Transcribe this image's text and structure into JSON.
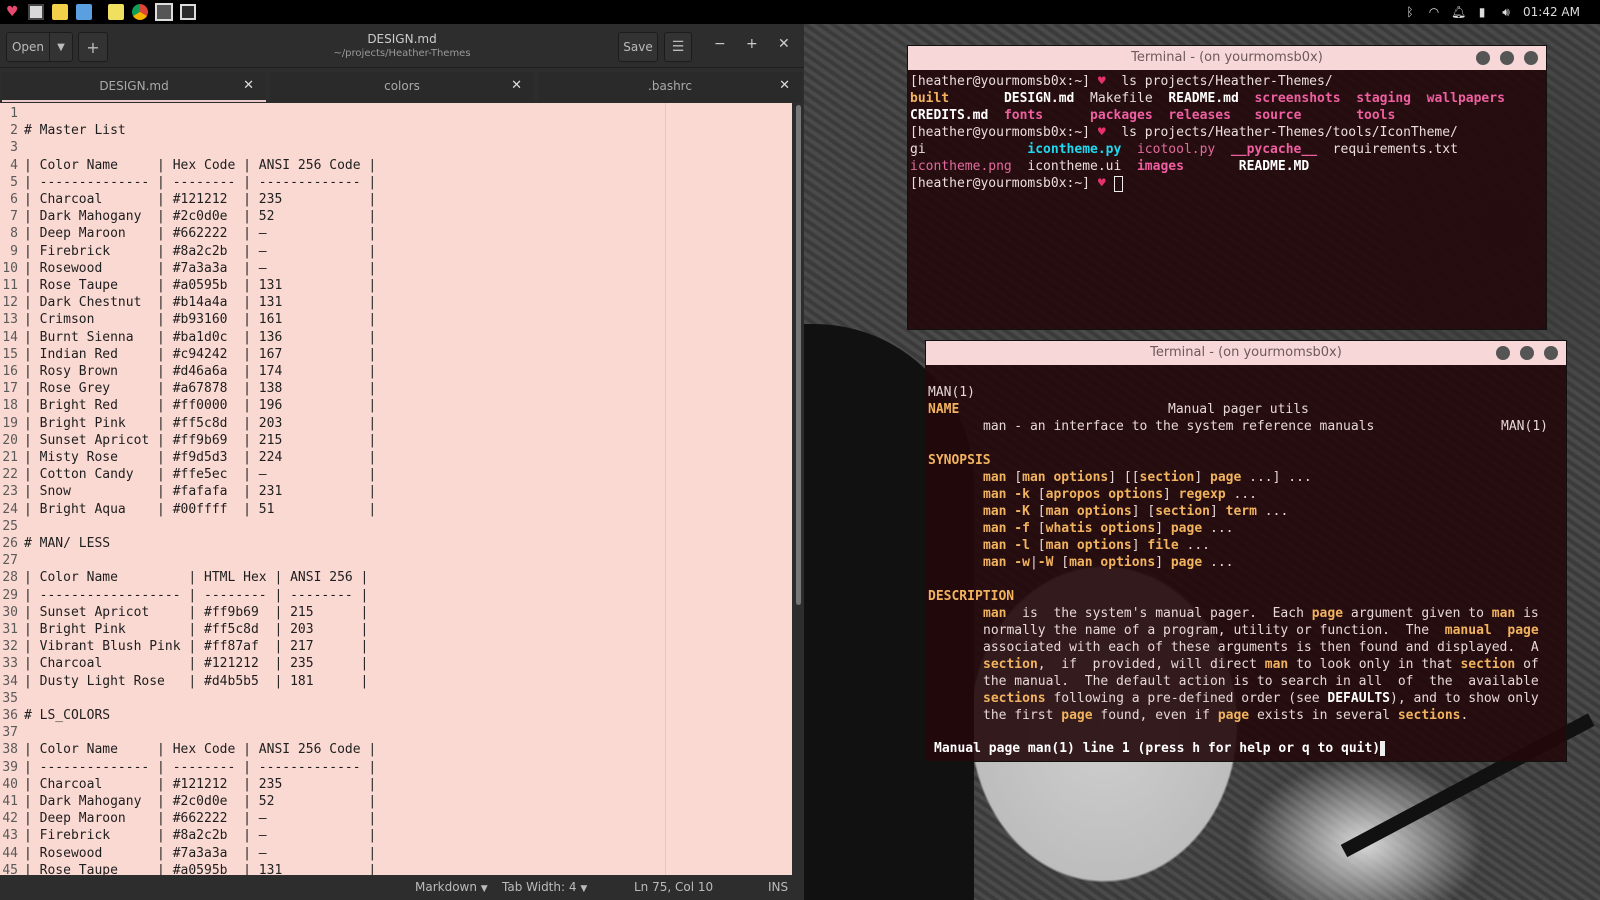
{
  "taskbar": {
    "clock": "01:42 AM",
    "apps": [
      {
        "icon": "heart-menu-icon",
        "color": "#e84a6f"
      },
      {
        "icon": "terminal-app-icon",
        "color": "#cfcfcf"
      },
      {
        "icon": "text-editor-icon",
        "color": "#f2d04a"
      },
      {
        "icon": "screenshot-app-icon",
        "color": "#5aa0e0"
      },
      {
        "icon": "notes-app-icon",
        "color": "#f0e060"
      },
      {
        "icon": "chrome-icon",
        "color": "#db4437"
      },
      {
        "icon": "terminal-app-icon-2",
        "color": "#cfcfcf"
      },
      {
        "icon": "terminal-app-icon-3",
        "color": "#cfcfcf"
      }
    ],
    "tray": [
      "bluetooth-icon",
      "wifi-icon",
      "notification-bell-icon",
      "battery-icon",
      "volume-icon"
    ]
  },
  "editor": {
    "open_label": "Open",
    "save_label": "Save",
    "title": "DESIGN.md",
    "subtitle": "~/projects/Heather-Themes",
    "tabs": [
      {
        "label": "DESIGN.md",
        "active": true
      },
      {
        "label": "colors",
        "active": false
      },
      {
        "label": ".bashrc",
        "active": false
      }
    ],
    "lines": [
      "",
      "# Master List",
      "",
      "| Color Name     | Hex Code | ANSI 256 Code |",
      "| -------------- | -------- | ------------- |",
      "| Charcoal       | #121212  | 235           |",
      "| Dark Mahogany  | #2c0d0e  | 52            |",
      "| Deep Maroon    | #662222  | –             |",
      "| Firebrick      | #8a2c2b  | –             |",
      "| Rosewood       | #7a3a3a  | –             |",
      "| Rose Taupe     | #a0595b  | 131           |",
      "| Dark Chestnut  | #b14a4a  | 131           |",
      "| Crimson        | #b93160  | 161           |",
      "| Burnt Sienna   | #ba1d0c  | 136           |",
      "| Indian Red     | #c94242  | 167           |",
      "| Rosy Brown     | #d46a6a  | 174           |",
      "| Rose Grey      | #a67878  | 138           |",
      "| Bright Red     | #ff0000  | 196           |",
      "| Bright Pink    | #ff5c8d  | 203           |",
      "| Sunset Apricot | #ff9b69  | 215           |",
      "| Misty Rose     | #f9d5d3  | 224           |",
      "| Cotton Candy   | #ffe5ec  | –             |",
      "| Snow           | #fafafa  | 231           |",
      "| Bright Aqua    | #00ffff  | 51            |",
      "",
      "# MAN/ LESS",
      "",
      "| Color Name         | HTML Hex | ANSI 256 |",
      "| ------------------ | -------- | -------- |",
      "| Sunset Apricot     | #ff9b69  | 215      |",
      "| Bright Pink        | #ff5c8d  | 203      |",
      "| Vibrant Blush Pink | #ff87af  | 217      |",
      "| Charcoal           | #121212  | 235      |",
      "| Dusty Light Rose   | #d4b5b5  | 181      |",
      "",
      "# LS_COLORS",
      "",
      "| Color Name     | Hex Code | ANSI 256 Code |",
      "| -------------- | -------- | ------------- |",
      "| Charcoal       | #121212  | 235           |",
      "| Dark Mahogany  | #2c0d0e  | 52            |",
      "| Deep Maroon    | #662222  | –             |",
      "| Firebrick      | #8a2c2b  | –             |",
      "| Rosewood       | #7a3a3a  | –             |",
      "| Rose Taupe     | #a0595b  | 131           |"
    ],
    "status": {
      "language": "Markdown",
      "tab_width": "Tab Width: 4",
      "position": "Ln 75, Col 10",
      "mode": "INS"
    }
  },
  "terminal1": {
    "title": "Terminal - (on yourmomsb0x)",
    "prompt_user": "[heather@yourmomsb0x:~]",
    "prompt_heart": "♥",
    "cmd1": "ls projects/Heather-Themes/",
    "ls1": {
      "row1": [
        "built",
        "DESIGN.md",
        "Makefile",
        "README.md",
        "screenshots",
        "staging",
        "wallpapers"
      ],
      "row2": [
        "CREDITS.md",
        "fonts",
        "packages",
        "releases",
        "source",
        "tools"
      ]
    },
    "cmd2": "ls projects/Heather-Themes/tools/IconTheme/",
    "ls2": {
      "row1": [
        "gi",
        "icontheme.py",
        "icotool.py",
        "__pycache__",
        "requirements.txt"
      ],
      "row2": [
        "icontheme.png",
        "icontheme.ui",
        "images",
        "README.MD"
      ]
    }
  },
  "terminal2": {
    "title": "Terminal - (on yourmomsb0x)",
    "header_left": "MAN(1)",
    "header_center": "Manual pager utils",
    "header_right": "MAN(1)",
    "name_heading": "NAME",
    "name_text": "man - an interface to the system reference manuals",
    "synopsis_heading": "SYNOPSIS",
    "description_heading": "DESCRIPTION",
    "status_line": "Manual page man(1) line 1 (press h for help or q to quit)"
  }
}
